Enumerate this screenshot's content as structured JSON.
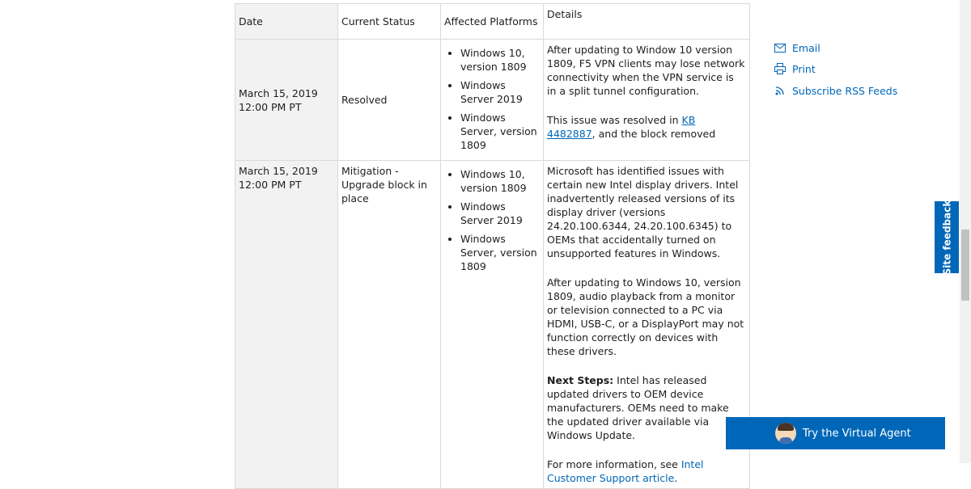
{
  "table": {
    "headers": {
      "date": "Date",
      "status": "Current Status",
      "platforms": "Affected Platforms",
      "details": "Details"
    },
    "rows": [
      {
        "date": "March 15, 2019 12:00 PM PT",
        "status": "Resolved",
        "platforms": [
          "Windows 10, version 1809",
          "Windows Server 2019",
          "Windows Server, version 1809"
        ],
        "details": {
          "p1": "After updating to Window 10 version 1809, F5 VPN clients may lose network connectivity when the VPN service is in a split tunnel configuration.",
          "p2_before": "This issue was resolved in ",
          "p2_link": "KB 4482887",
          "p2_after": ", and the block removed"
        }
      },
      {
        "date": "March 15, 2019 12:00 PM PT",
        "status": "Mitigation - Upgrade block in place",
        "platforms": [
          "Windows 10, version 1809",
          "Windows Server 2019",
          "Windows Server, version 1809"
        ],
        "details": {
          "p1": "Microsoft has identified issues with certain new Intel display drivers. Intel inadvertently released versions of its display driver (versions 24.20.100.6344, 24.20.100.6345) to OEMs that accidentally turned on unsupported features in Windows.",
          "p2": "After updating to Windows 10, version 1809, audio playback from a monitor or television connected to a PC via HDMI, USB-C, or a DisplayPort may not function correctly on devices with these drivers.",
          "p3_label": "Next Steps:",
          "p3": " Intel has released updated drivers to OEM device manufacturers. OEMs need to make the updated driver available via Windows Update.",
          "p4_before": "For more information, see ",
          "p4_link": "Intel Customer Support article",
          "p4_after": "."
        }
      }
    ]
  },
  "share": {
    "email": "Email",
    "print": "Print",
    "rss": "Subscribe RSS Feeds"
  },
  "feedback_label": "Site feedback",
  "virtual_agent_label": "Try the Virtual Agent",
  "colors": {
    "accent": "#0067b8",
    "date_bg": "#f2f2f2",
    "border": "#d9d9d9"
  },
  "icons": [
    "mail-icon",
    "print-icon",
    "rss-icon",
    "agent-avatar-icon"
  ]
}
